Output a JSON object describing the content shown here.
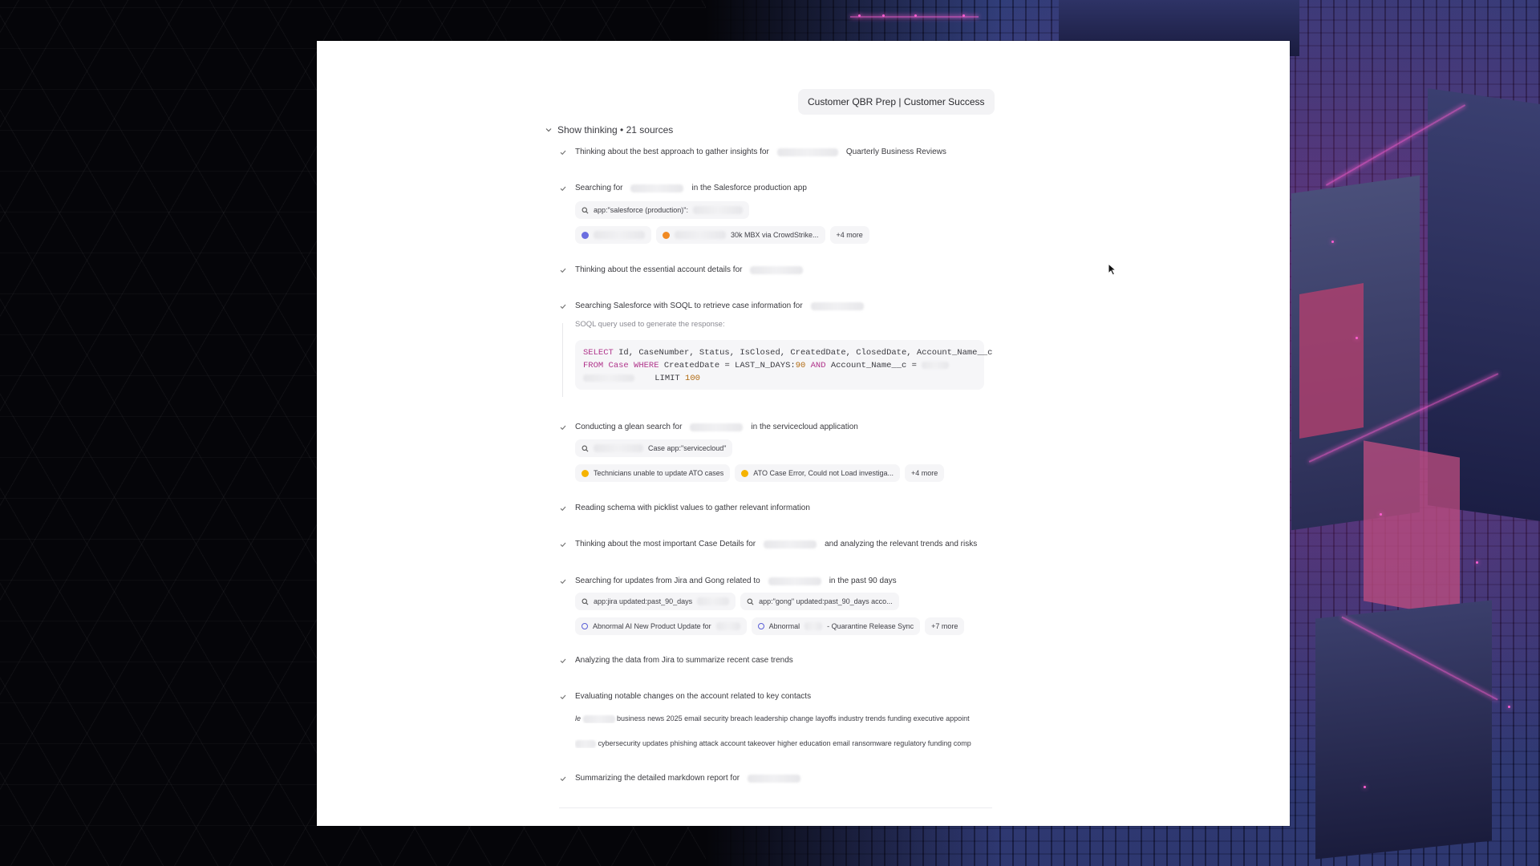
{
  "header": {
    "title": "Customer QBR Prep | Customer Success"
  },
  "thinking": {
    "toggle_label": "Show thinking • 21 sources"
  },
  "steps": [
    {
      "pre": "Thinking about the best approach to gather insights for",
      "post": "Quarterly Business Reviews"
    },
    {
      "pre": "Searching for",
      "post": "in the Salesforce production app"
    },
    {
      "pre": "Thinking about the essential account details for",
      "post": ""
    },
    {
      "pre": "Searching Salesforce with SOQL to retrieve case information for",
      "post": ""
    },
    {
      "pre": "Conducting a glean search for",
      "post": "in the servicecloud application"
    },
    {
      "pre": "Reading schema with picklist values to gather relevant information",
      "post": ""
    },
    {
      "pre": "Thinking about the most important Case Details for",
      "post": "and analyzing the relevant trends and risks"
    },
    {
      "pre": "Searching for updates from Jira and Gong related to",
      "post": "in the past 90 days"
    },
    {
      "pre": "Analyzing the data from Jira to summarize recent case trends",
      "post": ""
    },
    {
      "pre": "Evaluating notable changes on the account related to key contacts",
      "post": ""
    },
    {
      "pre": "Summarizing the detailed markdown report for",
      "post": ""
    }
  ],
  "salesforce": {
    "query": "app:\"salesforce (production)\":",
    "source_2": "30k MBX via CrowdStrike...",
    "more": "+4 more"
  },
  "soql": {
    "label": "SOQL query used to generate the response:",
    "kw_select": "SELECT",
    "fields": " Id, CaseNumber, Status, IsClosed, CreatedDate, ClosedDate, Account_Name__c",
    "kw_from": "FROM",
    "table": " Case ",
    "kw_where": "WHERE",
    "cond1": " CreatedDate = LAST_N_DAYS:",
    "days": "90",
    "kw_and": " AND",
    "cond2": " Account_Name__c =",
    "limit_kw": "LIMIT",
    "limit_val": "100"
  },
  "servicecloud": {
    "query": "Case app:\"servicecloud\"",
    "source_1": "Technicians unable to update ATO cases",
    "source_2": "ATO Case Error, Could not Load investiga...",
    "more": "+4 more"
  },
  "jira_gong": {
    "query_1": "app:jira updated:past_90_days",
    "query_2": "app:\"gong\" updated:past_90_days acco...",
    "source_1": "Abnormal AI New Product Update for",
    "source_2_pre": "Abnormal",
    "source_2_post": "- Quarantine Release Sync",
    "more": "+7 more"
  },
  "news": {
    "line_1_prefix": "le",
    "line_1": "business news 2025 email security breach leadership change layoffs industry trends funding executive appoint",
    "line_2": "cybersecurity updates phishing attack account takeover higher education email ransomware regulatory funding comp"
  },
  "colors": {
    "keyword": "#b0348b",
    "number": "#b26b12",
    "panel": "#ffffff"
  }
}
